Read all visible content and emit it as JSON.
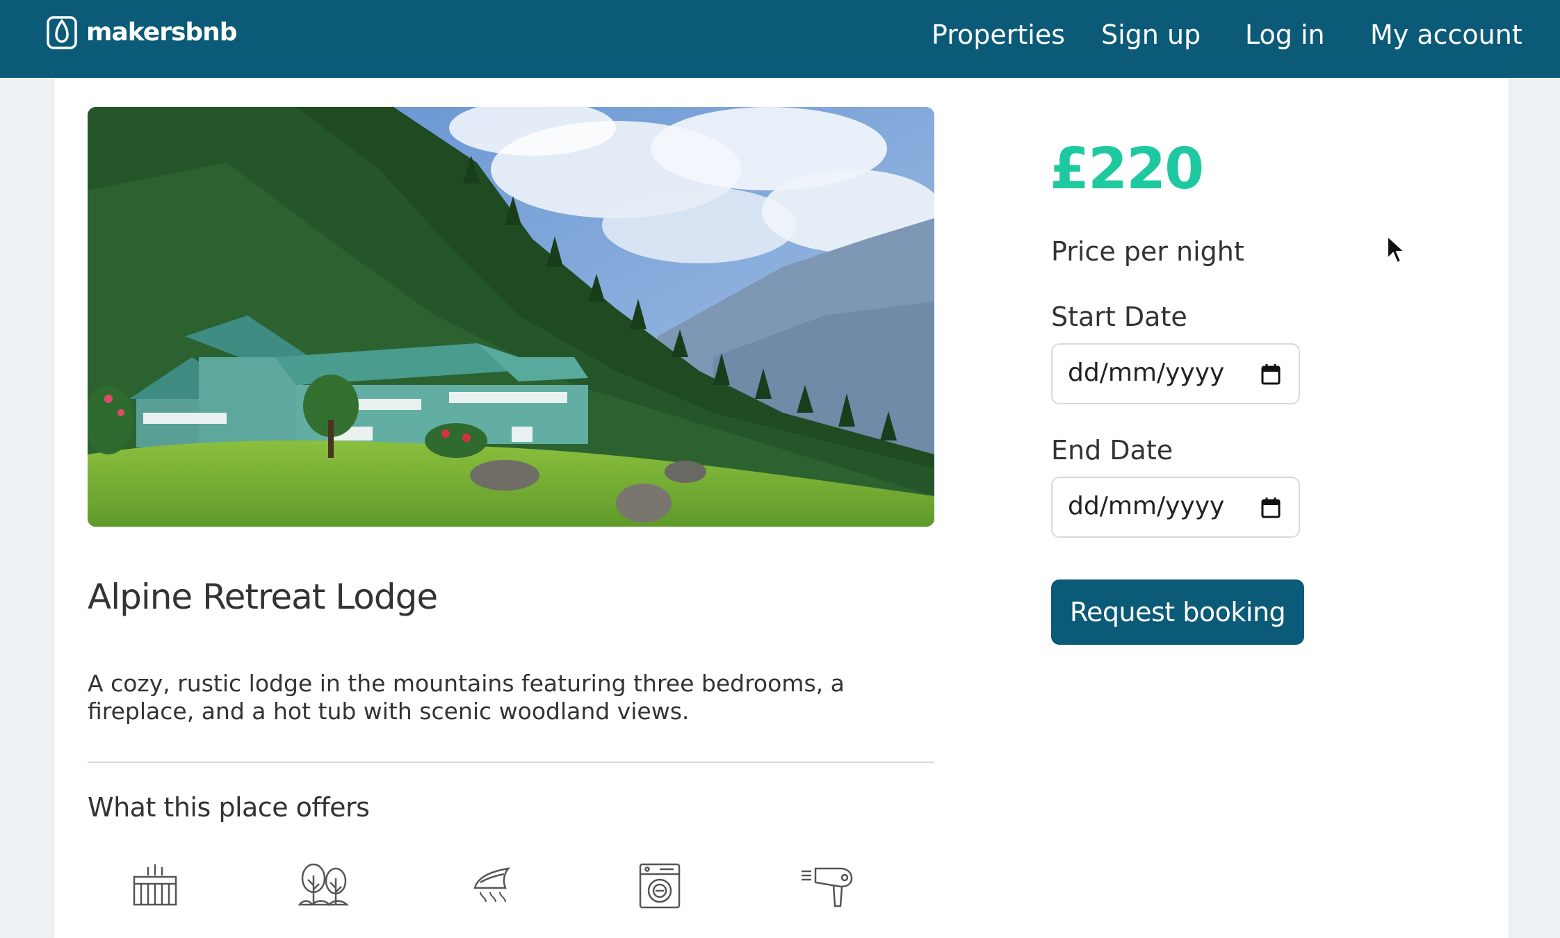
{
  "nav": {
    "brand": "makersbnb",
    "links": [
      "Properties",
      "Sign up",
      "Log in",
      "My account"
    ]
  },
  "property": {
    "title": "Alpine Retreat Lodge",
    "description": "A cozy, rustic lodge in the mountains featuring three bedrooms, a fireplace, and a hot tub with scenic woodland views."
  },
  "offers": {
    "heading": "What this place offers",
    "amenities": [
      {
        "icon": "heating-icon"
      },
      {
        "icon": "garden-icon"
      },
      {
        "icon": "iron-icon"
      },
      {
        "icon": "washer-icon"
      },
      {
        "icon": "hair-dryer-icon"
      }
    ]
  },
  "booking": {
    "price": "£220",
    "price_label": "Price per night",
    "start_label": "Start Date",
    "start_placeholder": "dd/mm/yyyy",
    "end_label": "End Date",
    "end_placeholder": "dd/mm/yyyy",
    "button": "Request booking"
  },
  "colors": {
    "navbar": "#0b5a78",
    "price": "#1fc9a0",
    "button": "#0b5a78"
  }
}
